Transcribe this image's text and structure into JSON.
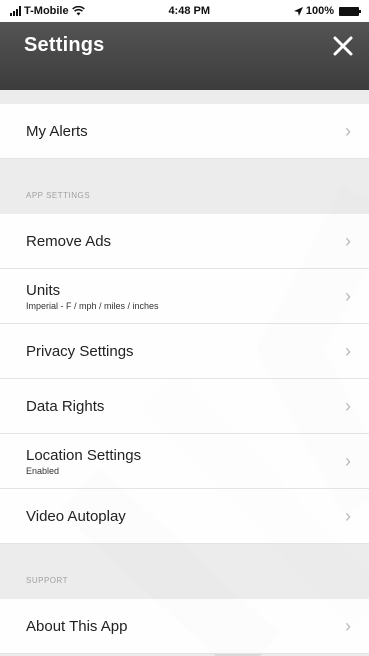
{
  "status_bar": {
    "carrier": "T-Mobile",
    "time": "4:48 PM",
    "battery": "100%"
  },
  "header": {
    "title": "Settings"
  },
  "rows": {
    "my_alerts": {
      "label": "My Alerts"
    },
    "app_settings_header": "APP SETTINGS",
    "remove_ads": {
      "label": "Remove Ads"
    },
    "units": {
      "label": "Units",
      "sub": "Imperial - F / mph / miles / inches"
    },
    "privacy": {
      "label": "Privacy Settings"
    },
    "data_rights": {
      "label": "Data Rights"
    },
    "location": {
      "label": "Location Settings",
      "sub": "Enabled"
    },
    "video_autoplay": {
      "label": "Video Autoplay"
    },
    "support_header": "SUPPORT",
    "about": {
      "label": "About This App"
    }
  },
  "icons": {
    "chevron": "›",
    "close": "close-icon",
    "wifi": "wifi-icon",
    "location_arrow": "location-arrow-icon"
  },
  "colors": {
    "header_bg": "#454545",
    "page_bg": "#ececec",
    "row_bg": "#ffffff",
    "chevron": "#b9b9b9"
  }
}
